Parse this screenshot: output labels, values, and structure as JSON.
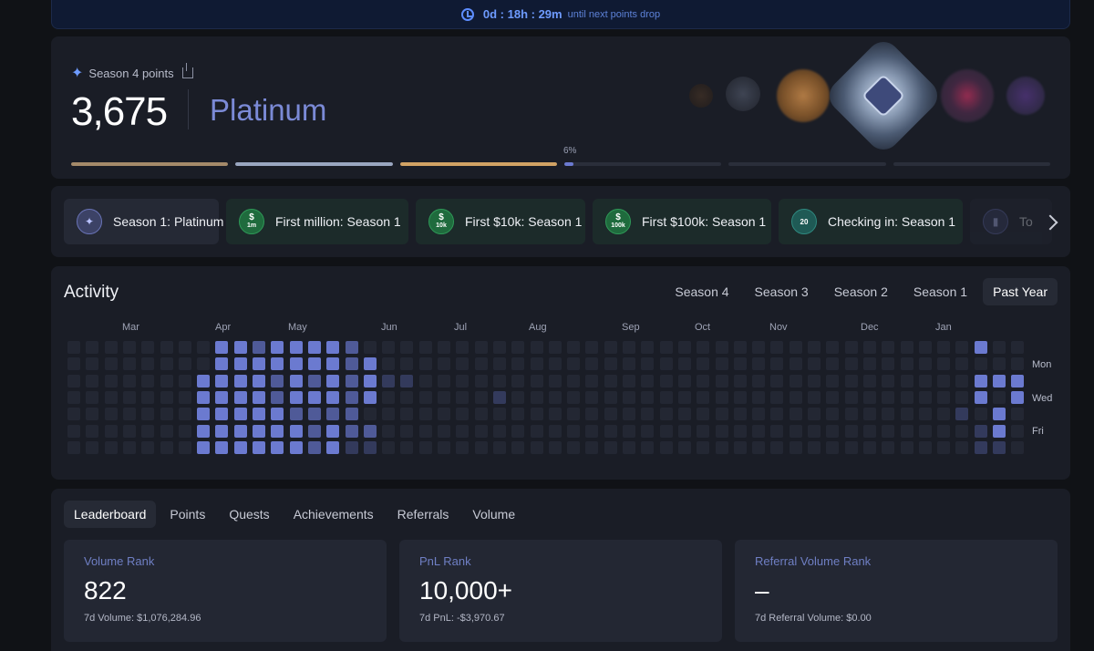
{
  "timer": {
    "countdown": "0d : 18h : 29m",
    "suffix": "until next points drop"
  },
  "points": {
    "label": "Season 4 points",
    "value": "3,675",
    "tier": "Platinum",
    "progress_label": "6%",
    "tier_progress": [
      1.0,
      1.0,
      1.0,
      0.06,
      0.0,
      0.0
    ]
  },
  "achievements": [
    {
      "label": "Season 1: Platinum",
      "icon": "platinum-star-icon",
      "kind": "plat",
      "glyph": "✦"
    },
    {
      "label": "First million: Season 1",
      "icon": "money-1m-icon",
      "kind": "money",
      "glyph": "$",
      "sub": "1m"
    },
    {
      "label": "First $10k: Season 1",
      "icon": "money-10k-icon",
      "kind": "money",
      "glyph": "$",
      "sub": "10k"
    },
    {
      "label": "First $100k: Season 1",
      "icon": "money-100k-icon",
      "kind": "money",
      "glyph": "$",
      "sub": "100k"
    },
    {
      "label": "Checking in: Season 1",
      "icon": "calendar-20-icon",
      "kind": "cal",
      "glyph": "20"
    },
    {
      "label": "To",
      "icon": "chart-icon",
      "kind": "plat",
      "glyph": "▮"
    }
  ],
  "activity": {
    "title": "Activity",
    "season_tabs": [
      "Season 4",
      "Season 3",
      "Season 2",
      "Season 1",
      "Past Year"
    ],
    "active_tab": "Past Year",
    "months": [
      "Mar",
      "Apr",
      "May",
      "Jun",
      "Jul",
      "Aug",
      "Sep",
      "Oct",
      "Nov",
      "Dec",
      "Jan"
    ],
    "day_labels": [
      "Mon",
      "Wed",
      "Fri"
    ]
  },
  "tabs": [
    "Leaderboard",
    "Points",
    "Quests",
    "Achievements",
    "Referrals",
    "Volume"
  ],
  "active_tab": "Leaderboard",
  "ranks": [
    {
      "label": "Volume Rank",
      "value": "822",
      "sub": "7d Volume: $1,076,284.96"
    },
    {
      "label": "PnL Rank",
      "value": "10,000+",
      "sub": "7d PnL: -$3,970.67"
    },
    {
      "label": "Referral Volume Rank",
      "value": "–",
      "sub": "7d Referral Volume: $0.00"
    }
  ],
  "colors": {
    "accent": "#7b8ad6",
    "cell_empty": "#232733",
    "cell_high": "#6b7ad0",
    "cell_mid": "#4f5a98",
    "cell_low": "#333a5c"
  }
}
